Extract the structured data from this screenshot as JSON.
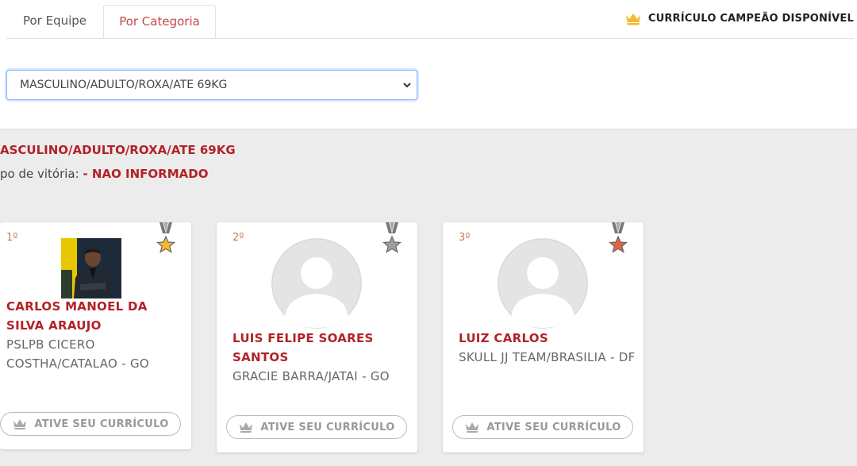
{
  "tabs": [
    {
      "label": "Por Equipe",
      "active": false
    },
    {
      "label": "Por Categoria",
      "active": true
    }
  ],
  "banner": {
    "icon": "crown-icon",
    "text": "CURRÍCULO CAMPEÃO DISPONÍVEL"
  },
  "category_select": {
    "value": "MASCULINO/ADULTO/ROXA/ATE 69KG"
  },
  "section": {
    "title": "ASCULINO/ADULTO/ROXA/ATE 69KG",
    "vitoria_label": "po de vitória:",
    "vitoria_value": "- NAO INFORMADO"
  },
  "colors": {
    "accent": "#b22228",
    "gold": "#f5b82e",
    "silver": "#a0a0a0",
    "bronze": "#e2643f"
  },
  "athletes": [
    {
      "place": "1º",
      "medal": "gold",
      "name": "CARLOS MANOEL DA SILVA ARAUJO",
      "team": "PSLPB CICERO COSTHA/CATALAO - GO",
      "has_photo": true,
      "button": "ATIVE SEU CURRÍCULO"
    },
    {
      "place": "2º",
      "medal": "silver",
      "name": "LUIS FELIPE SOARES SANTOS",
      "team": "GRACIE BARRA/JATAI - GO",
      "has_photo": false,
      "button": "ATIVE SEU CURRÍCULO"
    },
    {
      "place": "3º",
      "medal": "bronze",
      "name": "LUIZ CARLOS",
      "team": "SKULL JJ TEAM/BRASILIA - DF",
      "has_photo": false,
      "button": "ATIVE SEU CURRÍCULO"
    }
  ]
}
